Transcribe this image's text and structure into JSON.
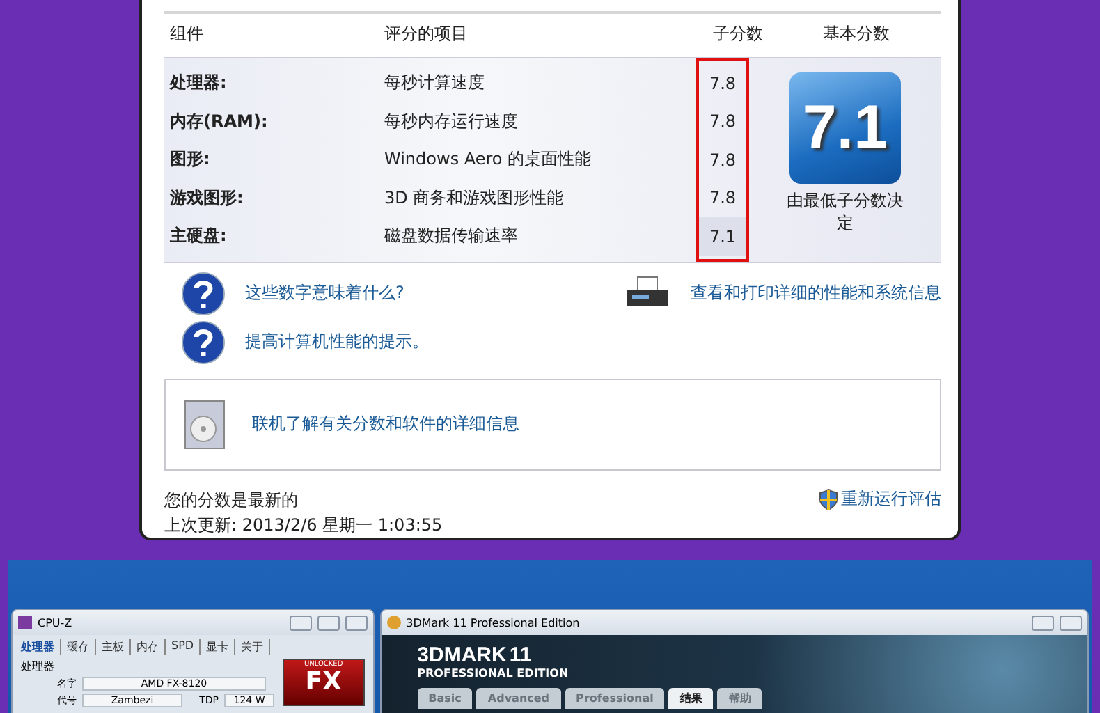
{
  "score_table": {
    "columns": [
      "组件",
      "评分的项目",
      "子分数",
      "基本分数"
    ],
    "rows": [
      {
        "component": "处理器:",
        "item": "每秒计算速度",
        "subscore": "7.8",
        "lowest": false
      },
      {
        "component": "内存(RAM):",
        "item": "每秒内存运行速度",
        "subscore": "7.8",
        "lowest": false
      },
      {
        "component": "图形:",
        "item": "Windows Aero 的桌面性能",
        "subscore": "7.8",
        "lowest": false
      },
      {
        "component": "游戏图形:",
        "item": "3D 商务和游戏图形性能",
        "subscore": "7.8",
        "lowest": false
      },
      {
        "component": "主硬盘:",
        "item": "磁盘数据传输速率",
        "subscore": "7.1",
        "lowest": true
      }
    ],
    "base_score": "7.1",
    "base_note": "由最低子分数决定"
  },
  "help_links": [
    "这些数字意味着什么?",
    "提高计算机性能的提示。"
  ],
  "print_link": "查看和打印详细的性能和系统信息",
  "online_link": "联机了解有关分数和软件的详细信息",
  "status": "您的分数是最新的",
  "last_update": "上次更新: 2013/2/6 星期一 1:03:55",
  "rerun_link": "重新运行评估",
  "cpuz": {
    "title": "CPU-Z",
    "tabs": [
      {
        "label": "处理器",
        "selected": true
      },
      {
        "label": "缓存",
        "selected": false
      },
      {
        "label": "主板",
        "selected": false
      },
      {
        "label": "内存",
        "selected": false
      },
      {
        "label": "SPD",
        "selected": false
      },
      {
        "label": "显卡",
        "selected": false
      },
      {
        "label": "关于",
        "selected": false
      }
    ],
    "group": "处理器",
    "name_label": "名字",
    "name_value": "AMD FX-8120",
    "code_label": "代号",
    "code_value": "Zambezi",
    "tdp_label": "TDP",
    "tdp_value": "124 W",
    "badge_top": "UNLOCKED",
    "badge_main": "FX"
  },
  "mark3d": {
    "title": "3DMark 11 Professional Edition",
    "logo": "3DMARK",
    "logo_num": "11",
    "edition": "PROFESSIONAL EDITION",
    "tabs": [
      {
        "label": "Basic",
        "selected": false
      },
      {
        "label": "Advanced",
        "selected": false
      },
      {
        "label": "Professional",
        "selected": false
      },
      {
        "label": "结果",
        "selected": true
      },
      {
        "label": "帮助",
        "selected": false
      }
    ]
  }
}
